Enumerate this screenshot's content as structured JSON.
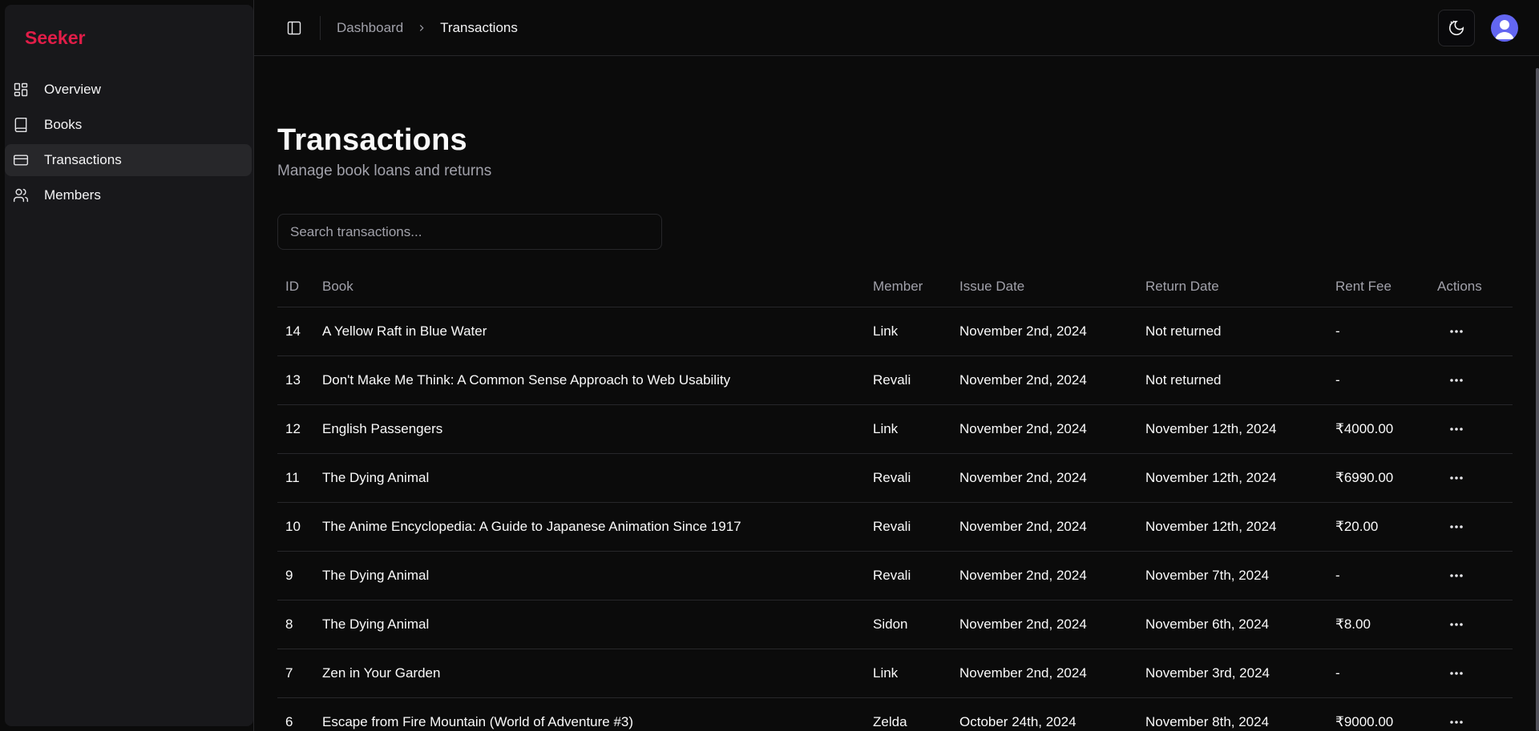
{
  "app": {
    "brand": "Seeker"
  },
  "sidebar": {
    "items": [
      {
        "label": "Overview",
        "icon": "layout-grid-icon"
      },
      {
        "label": "Books",
        "icon": "book-icon"
      },
      {
        "label": "Transactions",
        "icon": "credit-card-icon",
        "active": true
      },
      {
        "label": "Members",
        "icon": "users-icon"
      }
    ]
  },
  "header": {
    "breadcrumb": {
      "parent": "Dashboard",
      "current": "Transactions"
    }
  },
  "page": {
    "title": "Transactions",
    "subtitle": "Manage book loans and returns"
  },
  "search": {
    "placeholder": "Search transactions...",
    "value": ""
  },
  "table": {
    "columns": [
      "ID",
      "Book",
      "Member",
      "Issue Date",
      "Return Date",
      "Rent Fee",
      "Actions"
    ],
    "rows": [
      {
        "id": "14",
        "book": "A Yellow Raft in Blue Water",
        "member": "Link",
        "issue": "November 2nd, 2024",
        "return": "Not returned",
        "fee": "-"
      },
      {
        "id": "13",
        "book": "Don't Make Me Think: A Common Sense Approach to Web Usability",
        "member": "Revali",
        "issue": "November 2nd, 2024",
        "return": "Not returned",
        "fee": "-"
      },
      {
        "id": "12",
        "book": "English Passengers",
        "member": "Link",
        "issue": "November 2nd, 2024",
        "return": "November 12th, 2024",
        "fee": "₹4000.00"
      },
      {
        "id": "11",
        "book": "The Dying Animal",
        "member": "Revali",
        "issue": "November 2nd, 2024",
        "return": "November 12th, 2024",
        "fee": "₹6990.00"
      },
      {
        "id": "10",
        "book": "The Anime Encyclopedia: A Guide to Japanese Animation Since 1917",
        "member": "Revali",
        "issue": "November 2nd, 2024",
        "return": "November 12th, 2024",
        "fee": "₹20.00"
      },
      {
        "id": "9",
        "book": "The Dying Animal",
        "member": "Revali",
        "issue": "November 2nd, 2024",
        "return": "November 7th, 2024",
        "fee": "-"
      },
      {
        "id": "8",
        "book": "The Dying Animal",
        "member": "Sidon",
        "issue": "November 2nd, 2024",
        "return": "November 6th, 2024",
        "fee": "₹8.00"
      },
      {
        "id": "7",
        "book": "Zen in Your Garden",
        "member": "Link",
        "issue": "November 2nd, 2024",
        "return": "November 3rd, 2024",
        "fee": "-"
      },
      {
        "id": "6",
        "book": "Escape from Fire Mountain (World of Adventure #3)",
        "member": "Zelda",
        "issue": "October 24th, 2024",
        "return": "November 8th, 2024",
        "fee": "₹9000.00"
      }
    ]
  },
  "colors": {
    "brand": "#e11d48",
    "avatar": "#6366f1",
    "background": "#0b0b0b",
    "sidebar": "#18181b"
  }
}
